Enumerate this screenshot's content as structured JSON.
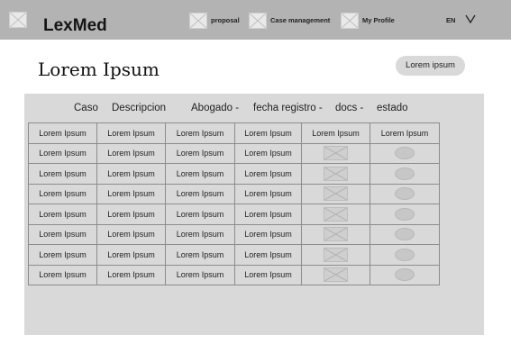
{
  "header": {
    "logo": "LexMed",
    "nav": [
      {
        "label": "proposal",
        "icon": "image-placeholder-icon"
      },
      {
        "label": "Case management",
        "icon": "image-placeholder-icon"
      },
      {
        "label": "My Profile",
        "icon": "image-placeholder-icon"
      }
    ],
    "language": "EN",
    "menu_icon": "chevron-down-icon"
  },
  "page": {
    "title": "Lorem Ipsum",
    "action_button": "Lorem ipsum"
  },
  "table": {
    "columns": [
      "Caso",
      "Descripcion",
      "Abogado -",
      "fecha registro -",
      "docs -",
      "estado"
    ],
    "header_row": [
      "Lorem Ipsum",
      "Lorem Ipsum",
      "Lorem Ipsum",
      "Lorem Ipsum",
      "Lorem Ipsum",
      "Lorem Ipsum"
    ],
    "rows": [
      [
        "Lorem Ipsum",
        "Lorem Ipsum",
        "Lorem Ipsum",
        "Lorem Ipsum"
      ],
      [
        "Lorem Ipsum",
        "Lorem Ipsum",
        "Lorem Ipsum",
        "Lorem Ipsum"
      ],
      [
        "Lorem Ipsum",
        "Lorem Ipsum",
        "Lorem Ipsum",
        "Lorem Ipsum"
      ],
      [
        "Lorem Ipsum",
        "Lorem Ipsum",
        "Lorem Ipsum",
        "Lorem Ipsum"
      ],
      [
        "Lorem Ipsum",
        "Lorem Ipsum",
        "Lorem Ipsum",
        "Lorem Ipsum"
      ],
      [
        "Lorem Ipsum",
        "Lorem Ipsum",
        "Lorem Ipsum",
        "Lorem Ipsum"
      ],
      [
        "Lorem Ipsum",
        "Lorem Ipsum",
        "Lorem Ipsum",
        "Lorem Ipsum"
      ]
    ],
    "docs_icon": "image-placeholder-icon",
    "status_icon": "status-dot-icon"
  },
  "colors": {
    "topbar": "#b3b3b3",
    "panel": "#d9d9d9",
    "button": "#d9d9d9"
  }
}
